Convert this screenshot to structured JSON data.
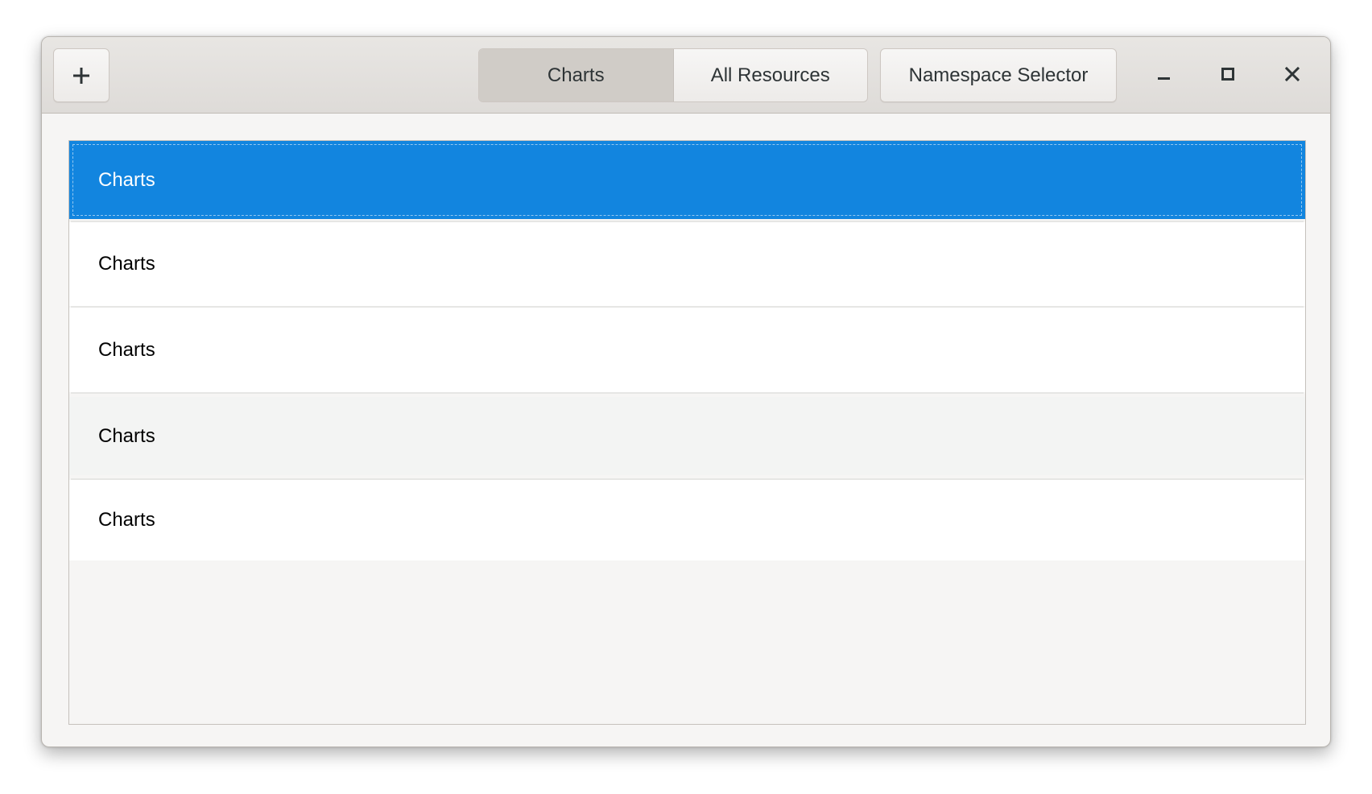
{
  "headerbar": {
    "add_icon": "plus-icon",
    "tabs": [
      {
        "label": "Charts",
        "active": true
      },
      {
        "label": "All Resources",
        "active": false
      }
    ],
    "namespace_button": "Namespace Selector",
    "window_controls": [
      "minimize-icon",
      "maximize-icon",
      "close-icon"
    ]
  },
  "list": {
    "items": [
      {
        "label": "Charts",
        "state": "selected"
      },
      {
        "label": "Charts",
        "state": "normal"
      },
      {
        "label": "Charts",
        "state": "normal"
      },
      {
        "label": "Charts",
        "state": "hover"
      },
      {
        "label": "Charts",
        "state": "normal"
      }
    ]
  },
  "colors": {
    "selection": "#1285df",
    "headerbar": "#dedbd8",
    "window_bg": "#f6f5f4"
  }
}
